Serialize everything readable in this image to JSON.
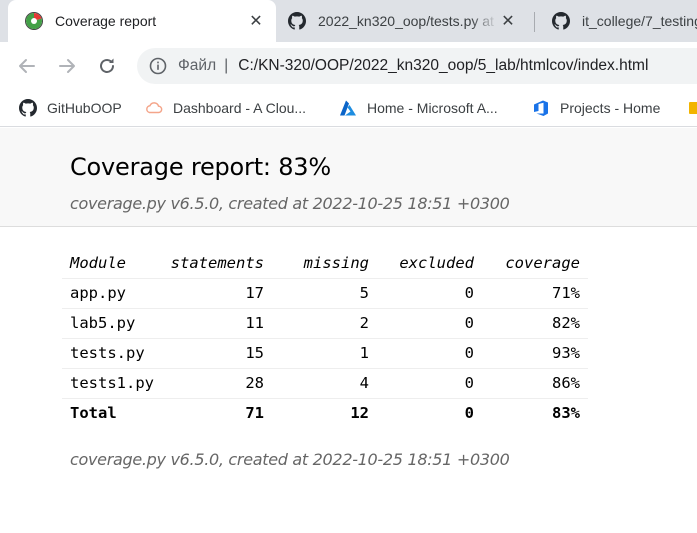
{
  "browser": {
    "tabs": [
      {
        "title": "Coverage report",
        "active": true,
        "icon": "coverage-favicon"
      },
      {
        "title": "2022_kn320_oop/tests.py at",
        "active": false,
        "icon": "github-icon"
      },
      {
        "title": "it_college/7_testing",
        "active": false,
        "icon": "github-icon"
      }
    ],
    "close_glyph": "✕",
    "address": {
      "scheme_label": "Файл",
      "separator": "|",
      "url": "C:/KN-320/OOP/2022_kn320_oop/5_lab/htmlcov/index.html"
    },
    "bookmarks": [
      {
        "label": "GitHubOOP",
        "icon": "github-icon"
      },
      {
        "label": "Dashboard - A Clou...",
        "icon": "cloud-icon"
      },
      {
        "label": "Home - Microsoft A...",
        "icon": "azure-icon"
      },
      {
        "label": "Projects - Home",
        "icon": "devops-icon"
      }
    ]
  },
  "report": {
    "title": "Coverage report: 83%",
    "subtitle": "coverage.py v6.5.0, created at 2022-10-25 18:51 +0300",
    "footer": "coverage.py v6.5.0, created at 2022-10-25 18:51 +0300",
    "columns": {
      "module": "Module",
      "statements": "statements",
      "missing": "missing",
      "excluded": "excluded",
      "coverage": "coverage"
    },
    "rows": [
      {
        "module": "app.py",
        "statements": "17",
        "missing": "5",
        "excluded": "0",
        "coverage": "71%"
      },
      {
        "module": "lab5.py",
        "statements": "11",
        "missing": "2",
        "excluded": "0",
        "coverage": "82%"
      },
      {
        "module": "tests.py",
        "statements": "15",
        "missing": "1",
        "excluded": "0",
        "coverage": "93%"
      },
      {
        "module": "tests1.py",
        "statements": "28",
        "missing": "4",
        "excluded": "0",
        "coverage": "86%"
      }
    ],
    "total": {
      "module": "Total",
      "statements": "71",
      "missing": "12",
      "excluded": "0",
      "coverage": "83%"
    }
  }
}
